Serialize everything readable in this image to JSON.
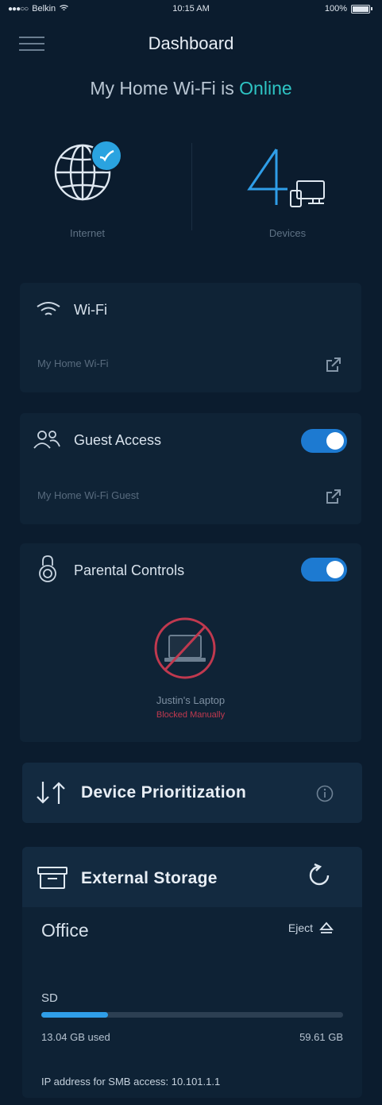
{
  "status_bar": {
    "carrier": "Belkin",
    "time": "10:15 AM",
    "battery": "100%"
  },
  "header": {
    "title": "Dashboard",
    "status_prefix": "My Home Wi-Fi is",
    "status_value": "Online"
  },
  "summary": {
    "internet_label": "Internet",
    "devices_count": "4",
    "devices_label": "Devices"
  },
  "wifi": {
    "title": "Wi-Fi",
    "network_name": "My Home Wi-Fi"
  },
  "guest": {
    "title": "Guest Access",
    "network_name": "My Home Wi-Fi Guest",
    "enabled": true
  },
  "parental": {
    "title": "Parental Controls",
    "enabled": true,
    "device_name": "Justin's Laptop",
    "device_status": "Blocked Manually"
  },
  "prioritization": {
    "title": "Device Prioritization"
  },
  "storage": {
    "title": "External Storage",
    "drive_name": "Office",
    "eject_label": "Eject",
    "volume_label": "SD",
    "used": "13.04 GB used",
    "total": "59.61 GB",
    "used_fraction": 0.22,
    "smb_text": "IP address for SMB access: 10.101.1.1"
  },
  "colors": {
    "background": "#0b1c2e",
    "card": "#0f2336",
    "accent_teal": "#2ec4c4",
    "toggle_blue": "#1d7ad1",
    "blocked_red": "#c0394f"
  }
}
